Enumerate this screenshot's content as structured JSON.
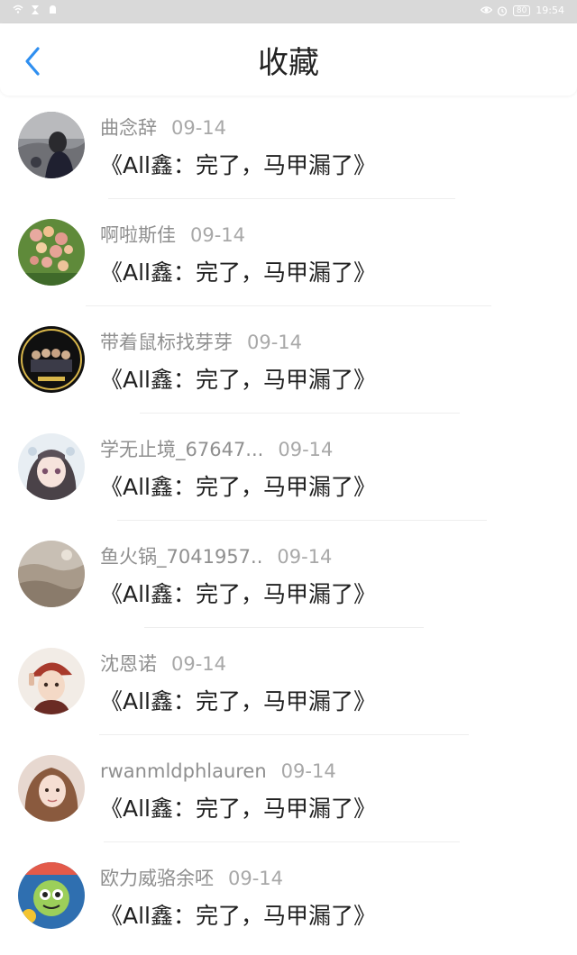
{
  "status_bar": {
    "time": "19:54",
    "battery": "80",
    "left_icons": [
      "wifi-icon",
      "hourglass-icon",
      "notification-icon"
    ],
    "right_icons": [
      "eye-icon",
      "alarm-icon",
      "battery-icon"
    ]
  },
  "header": {
    "title": "收藏",
    "back_icon": "chevron-left-icon"
  },
  "colors": {
    "accent": "#2f8ff0",
    "status_bar_bg": "#d9d9d9",
    "username": "#8f8f8f",
    "date": "#a8a8a8",
    "title_text": "#1f1f1f"
  },
  "items": [
    {
      "user": "曲念辞",
      "date": "09-14",
      "title": "《All鑫：完了，马甲漏了》",
      "avatar": "avatar-photo-girl-sitting"
    },
    {
      "user": "啊啦斯佳",
      "date": "09-14",
      "title": "《All鑫：完了，马甲漏了》",
      "avatar": "avatar-flowers"
    },
    {
      "user": "带着鼠标找芽芽",
      "date": "09-14",
      "title": "《All鑫：完了，马甲漏了》",
      "avatar": "avatar-group-photo"
    },
    {
      "user": "学无止境_67647...",
      "date": "09-14",
      "title": "《All鑫：完了，马甲漏了》",
      "avatar": "avatar-anime-girl"
    },
    {
      "user": "鱼火锅_7041957..",
      "date": "09-14",
      "title": "《All鑫：完了，马甲漏了》",
      "avatar": "avatar-landscape"
    },
    {
      "user": "沈恩诺",
      "date": "09-14",
      "title": "《All鑫：完了，马甲漏了》",
      "avatar": "avatar-girl-red-hat"
    },
    {
      "user": "rwanmldphlauren",
      "date": "09-14",
      "title": "《All鑫：完了，马甲漏了》",
      "avatar": "avatar-girl-portrait"
    },
    {
      "user": "欧力威骆余呸",
      "date": "09-14",
      "title": "《All鑫：完了，马甲漏了》",
      "avatar": "avatar-cartoon-character"
    }
  ]
}
